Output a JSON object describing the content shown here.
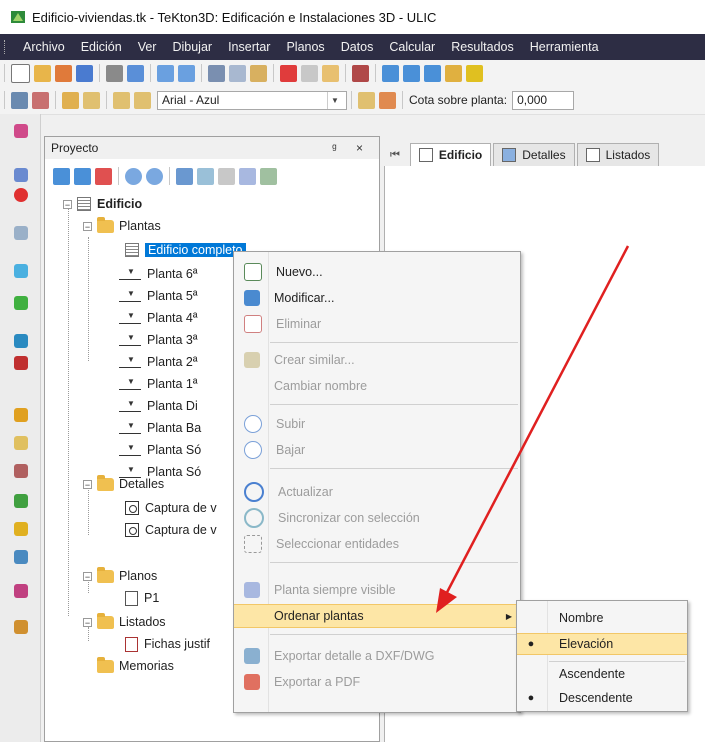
{
  "window": {
    "title": "Edificio-viviendas.tk - TeKton3D: Edificación e Instalaciones 3D - ULIC"
  },
  "menubar": {
    "items": [
      "Archivo",
      "Edición",
      "Ver",
      "Dibujar",
      "Insertar",
      "Planos",
      "Datos",
      "Calcular",
      "Resultados",
      "Herramienta"
    ]
  },
  "toolbar2": {
    "text_style": "Arial - Azul",
    "cota_label": "Cota sobre planta:",
    "cota_value": "0,000"
  },
  "panel": {
    "title": "Proyecto",
    "pin_close": "ᵍ ×"
  },
  "tree": {
    "root": "Edificio",
    "plantas": "Plantas",
    "edificio_completo": "Edificio completo",
    "floors": [
      "Planta 6ª",
      "Planta 5ª",
      "Planta 4ª",
      "Planta 3ª",
      "Planta 2ª",
      "Planta 1ª",
      "Planta Di",
      "Planta Ba",
      "Planta Só",
      "Planta Só"
    ],
    "detalles": "Detalles",
    "captura_1": "Captura de v",
    "captura_2": "Captura de v",
    "planos": "Planos",
    "p1": "P1",
    "listados": "Listados",
    "fichas": "Fichas justif",
    "memorias": "Memorias"
  },
  "tabs": {
    "nav": "⏮",
    "edificio": "Edificio",
    "detalles": "Detalles",
    "listados": "Listados"
  },
  "context_menu": {
    "nuevo": "Nuevo...",
    "modificar": "Modificar...",
    "eliminar": "Eliminar",
    "crear_similar": "Crear similar...",
    "cambiar_nombre": "Cambiar nombre",
    "subir": "Subir",
    "bajar": "Bajar",
    "actualizar": "Actualizar",
    "sincronizar": "Sincronizar con selección",
    "seleccionar": "Seleccionar entidades",
    "planta_visible": "Planta siempre visible",
    "ordenar": "Ordenar plantas",
    "exportar_dxf": "Exportar detalle a DXF/DWG",
    "exportar_pdf": "Exportar a PDF"
  },
  "submenu": {
    "nombre": "Nombre",
    "elevacion": "Elevación",
    "ascendente": "Ascendente",
    "descendente": "Descendente",
    "bullet": "●"
  },
  "colors": {
    "menubar": "#2d2d44",
    "selection": "#0078d7",
    "highlight": "#fde6a6",
    "annotation_arrow": "#e02020"
  }
}
